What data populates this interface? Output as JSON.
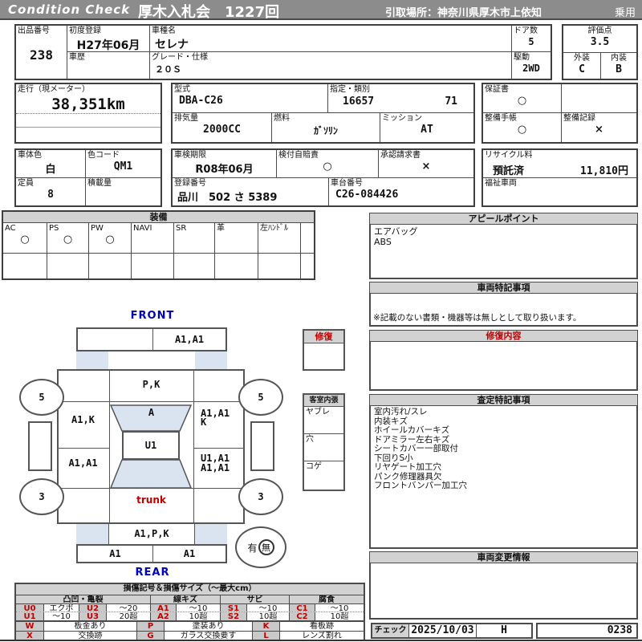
{
  "colors": {
    "header_bg": "#8c8c8c",
    "section_bg": "#d2d2d2",
    "glass_blue": "#d9e4f0",
    "accent_red": "#c00000",
    "accent_blue": "#0000bb"
  },
  "header": {
    "brand": "Condition  Check",
    "title": "厚木入札会　1227回",
    "pickup": "引取場所：神奈川県厚木市上依知",
    "category": "乗用"
  },
  "info": {
    "lot_label": "出品番号",
    "lot_value": "238",
    "first_reg_label": "初度登録",
    "first_reg_value": "H27年06月",
    "history_label": "車歴",
    "history_value": "",
    "model_name_label": "車種名",
    "model_name_value": "セレナ",
    "grade_label": "グレード・仕様",
    "grade_value": "２０Ｓ",
    "doors_label": "ドア数",
    "doors_value": "5",
    "drive_label": "駆動",
    "drive_value": "2WD",
    "score_label": "評価点",
    "score_value": "3.5",
    "exterior_label": "外装",
    "exterior_value": "C",
    "interior_label": "内装",
    "interior_value": "B",
    "mileage_label": "走行（現メーター）",
    "mileage_value": "38,351km",
    "model_code_label": "型式",
    "model_code_value": "DBA-C26",
    "type_label": "指定・類別",
    "type_value1": "16657",
    "type_value2": "71",
    "displacement_label": "排気量",
    "displacement_value": "2000CC",
    "fuel_label": "燃料",
    "fuel_value": "ｶﾞｿﾘﾝ",
    "mission_label": "ミッション",
    "mission_value": "AT",
    "warranty_label": "保証書",
    "warranty_value": "○",
    "service_book_label": "整備手帳",
    "service_book_value": "○",
    "service_record_label": "整備記録",
    "service_record_value": "×",
    "body_color_label": "車体色",
    "body_color_value": "白",
    "color_code_label": "色コード",
    "color_code_value": "QM1",
    "inspection_label": "車検期限",
    "inspection_value": "R08年06月",
    "insurance_label": "検付自賠責",
    "insurance_value": "○",
    "approval_label": "承認請求書",
    "approval_value": "×",
    "recycle_label": "リサイクル料",
    "recycle_status": "預託済",
    "recycle_fee": "11,810円",
    "capacity_label": "定員",
    "capacity_value": "8",
    "load_label": "積載量",
    "load_value": "",
    "reg_no_label": "登録番号",
    "reg_no_value": "品川　502 さ 5389",
    "chassis_label": "車台番号",
    "chassis_value": "C26-084426",
    "welfare_label": "福祉車両",
    "welfare_value": ""
  },
  "equipment": {
    "title": "装備",
    "items": [
      {
        "label": "AC",
        "value": "○"
      },
      {
        "label": "PS",
        "value": "○"
      },
      {
        "label": "PW",
        "value": "○"
      },
      {
        "label": "NAVI",
        "value": ""
      },
      {
        "label": "SR",
        "value": ""
      },
      {
        "label": "革",
        "value": ""
      },
      {
        "label": "左ﾊﾝﾄﾞﾙ",
        "value": ""
      }
    ]
  },
  "appeal": {
    "title": "アピールポイント",
    "lines": [
      "エアバッグ",
      "ABS"
    ]
  },
  "special_notes": {
    "title": "車両特記事項",
    "note": "※記載のない書類・機器等は無しとして取り扱います。"
  },
  "repair": {
    "title": "修復内容",
    "content": ""
  },
  "assessment": {
    "title": "査定特記事項",
    "lines": [
      "室内汚れ/スレ",
      "内装キズ",
      "ホイールカバーキズ",
      "ドアミラー左右キズ",
      "シートカバー一部取付",
      "下回りS小",
      "リヤゲート加工穴",
      "パンク修理器具欠",
      "フロントバンパー加工穴"
    ]
  },
  "change_info": {
    "title": "車両変更情報",
    "content": ""
  },
  "check": {
    "label": "チェック",
    "date": "2025/10/03",
    "inspector": "H",
    "number": "0238"
  },
  "diagram": {
    "front_label": "FRONT",
    "rear_label": "REAR",
    "bumper_front_right": "A1,A1",
    "hood": "P,K",
    "windshield": "A",
    "door_front_left": "A1,K",
    "door_front_right_1": "A1,A1",
    "door_front_right_2": "K",
    "roof": "U1",
    "panel_rear_left": "A1,A1",
    "panel_rear_right_1": "U1,A1",
    "panel_rear_right_2": "A1,A1",
    "trunk": "trunk",
    "rear_panel": "A1,P,K",
    "bumper_rear_left": "A1",
    "bumper_rear_right": "A1",
    "wheel_fl": "5",
    "wheel_fr": "5",
    "wheel_rl": "3",
    "wheel_rr": "3",
    "spare_has": "有",
    "spare_none": "無",
    "mini_repair_title": "修復",
    "interior_title": "客室内張",
    "interior_rows": [
      "ヤブレ",
      "穴",
      "コゲ"
    ]
  },
  "legend": {
    "title": "損傷記号＆損傷サイズ（〜最大cm）",
    "groups": [
      "凸凹・亀裂",
      "線キズ",
      "サビ",
      "腐食"
    ],
    "rows": [
      [
        "U0",
        "エクボ",
        "U2",
        "〜20",
        "A1",
        "〜10",
        "S1",
        "〜10",
        "C1",
        "〜10"
      ],
      [
        "U1",
        "〜10",
        "U3",
        "20超",
        "A2",
        "10超",
        "S2",
        "10超",
        "C2",
        "10超"
      ]
    ],
    "bottom_rows": [
      [
        "W",
        "板金あり",
        "P",
        "塗装あり",
        "K",
        "看板跡"
      ],
      [
        "X",
        "交換跡",
        "G",
        "ガラス交換要す",
        "L",
        "レンズ割れ"
      ]
    ]
  }
}
